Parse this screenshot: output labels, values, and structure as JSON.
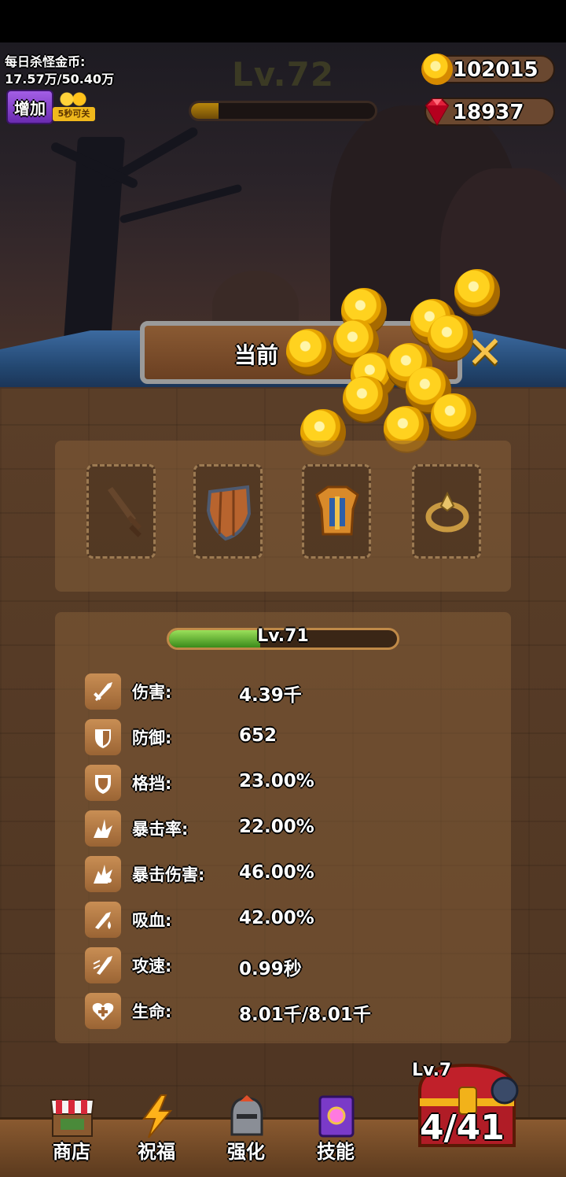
{
  "hud": {
    "daily_label": "每日杀怪金币:",
    "daily_value": "17.57万/50.40万",
    "add_button": "增加",
    "skip_badge": "5秒可关",
    "level": "Lv.72",
    "level_progress": 0.15,
    "gold": "102015",
    "gems": "18937"
  },
  "banner": {
    "title": "当前"
  },
  "equipment": {
    "slots": [
      {
        "name": "sword",
        "label": ""
      },
      {
        "name": "shield",
        "label": ""
      },
      {
        "name": "armor",
        "label": ""
      },
      {
        "name": "ring",
        "label": ""
      }
    ]
  },
  "stats": {
    "level": "Lv.71",
    "level_progress": 0.4,
    "rows": [
      {
        "label": "伤害:",
        "value": "4.39千",
        "icon": "sword-icon"
      },
      {
        "label": "防御:",
        "value": "652",
        "icon": "shield-half-icon"
      },
      {
        "label": "格挡:",
        "value": "23.00%",
        "icon": "block-shield-icon"
      },
      {
        "label": "暴击率:",
        "value": "22.00%",
        "icon": "crit-burst-icon"
      },
      {
        "label": "暴击伤害:",
        "value": "46.00%",
        "icon": "crit-damage-icon"
      },
      {
        "label": "吸血:",
        "value": "42.00%",
        "icon": "lifesteal-icon"
      },
      {
        "label": "攻速:",
        "value": "0.99秒",
        "icon": "attack-speed-icon"
      },
      {
        "label": "生命:",
        "value": "8.01千/8.01千",
        "icon": "heart-plus-icon"
      }
    ]
  },
  "nav": {
    "shop": "商店",
    "blessing": "祝福",
    "enhance": "强化",
    "skills": "技能"
  },
  "chest": {
    "level": "Lv.7",
    "count": "4/41"
  },
  "colors": {
    "gold": "#ffd21f",
    "gem": "#e0203a",
    "xp_green": "#7fd045",
    "panel": "#5a3e28"
  }
}
